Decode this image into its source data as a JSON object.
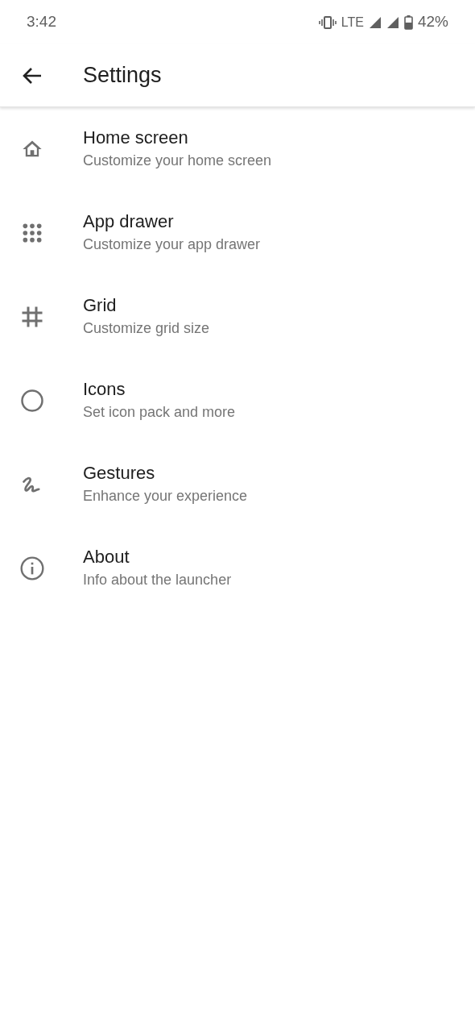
{
  "status_bar": {
    "time": "3:42",
    "network": "LTE",
    "battery": "42%"
  },
  "toolbar": {
    "title": "Settings"
  },
  "items": [
    {
      "title": "Home screen",
      "subtitle": "Customize your home screen"
    },
    {
      "title": "App drawer",
      "subtitle": "Customize your app drawer"
    },
    {
      "title": "Grid",
      "subtitle": "Customize grid size"
    },
    {
      "title": "Icons",
      "subtitle": "Set icon pack and more"
    },
    {
      "title": "Gestures",
      "subtitle": "Enhance your experience"
    },
    {
      "title": "About",
      "subtitle": "Info about the launcher"
    }
  ]
}
